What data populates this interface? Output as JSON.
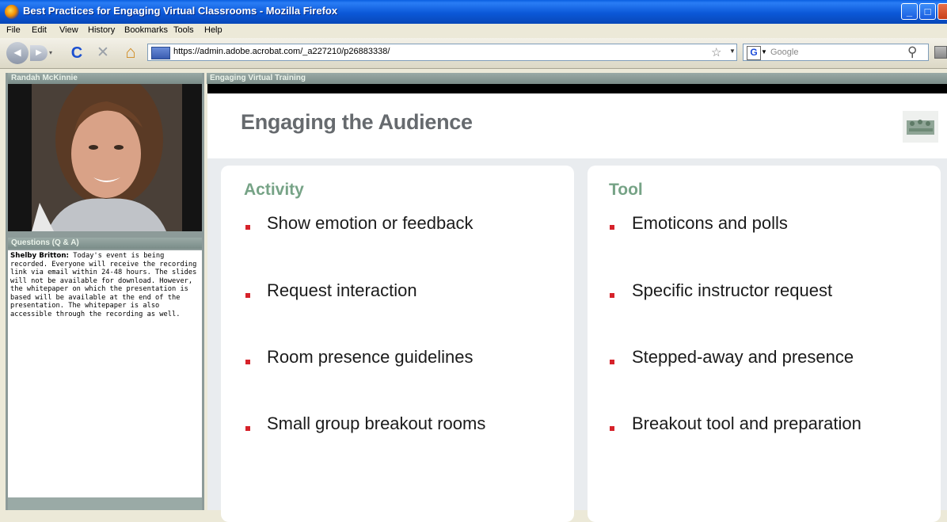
{
  "window": {
    "title": "Best Practices for Engaging Virtual Classrooms - Mozilla Firefox",
    "controls": {
      "minimize": "_",
      "maximize": "□",
      "close": "×"
    }
  },
  "menu": {
    "items": [
      {
        "label": "File"
      },
      {
        "label": "Edit"
      },
      {
        "label": "View"
      },
      {
        "label": "History"
      },
      {
        "label": "Bookmarks"
      },
      {
        "label": "Tools"
      },
      {
        "label": "Help"
      }
    ]
  },
  "nav": {
    "url": "https://admin.adobe.acrobat.com/_a227210/p26883338/",
    "search_placeholder": "Google",
    "search_engine_letter": "G",
    "icons": {
      "back": "◀",
      "forward": "▶",
      "reload": "C",
      "stop": "✕",
      "home": "⌂",
      "bookmark_star": "☆",
      "search": "⚲"
    }
  },
  "left": {
    "video_title": "Randah McKinnie",
    "qa_title": "Questions (Q & A)",
    "qa_author": "Shelby Britton:",
    "qa_message": "Today's event is being recorded. Everyone will receive the recording link via email within 24-48 hours. The slides will not be available for download. However, the whitepaper on which the presentation is based will be available at the end of the presentation.  The whitepaper is also accessible through the recording as well."
  },
  "main": {
    "pod_title": "Engaging Virtual Training",
    "slide": {
      "title": "Engaging the Audience",
      "columns": [
        {
          "heading": "Activity",
          "items": [
            "Show emotion or feedback",
            "Request interaction",
            "Room presence guidelines",
            "Small group breakout rooms"
          ]
        },
        {
          "heading": "Tool",
          "items": [
            "Emoticons and polls",
            "Specific instructor request",
            "Stepped-away and presence",
            "Breakout tool and preparation"
          ]
        }
      ]
    }
  },
  "colors": {
    "titlebar": "#0b58d8",
    "panel_header": "#8d9b99",
    "column_heading": "#76a386",
    "bullet": "#d6222a",
    "slide_title": "#666a6e"
  }
}
